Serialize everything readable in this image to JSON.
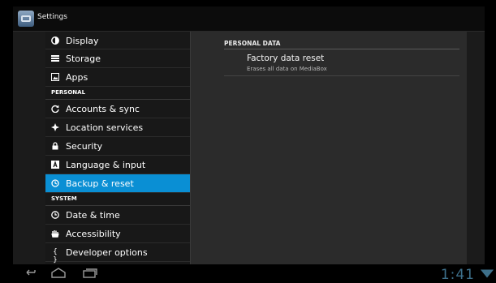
{
  "app": {
    "title": "Settings",
    "icon": "settings-app-icon"
  },
  "sidebar": {
    "items_top": [
      {
        "label": "Display",
        "icon": "display-icon"
      },
      {
        "label": "Storage",
        "icon": "storage-icon"
      },
      {
        "label": "Apps",
        "icon": "apps-icon"
      }
    ],
    "section_personal": "PERSONAL",
    "items_personal": [
      {
        "label": "Accounts & sync",
        "icon": "sync-icon"
      },
      {
        "label": "Location services",
        "icon": "location-icon"
      },
      {
        "label": "Security",
        "icon": "lock-icon"
      },
      {
        "label": "Language & input",
        "icon": "keyboard-icon"
      },
      {
        "label": "Backup & reset",
        "icon": "backup-icon",
        "selected": true
      }
    ],
    "section_system": "SYSTEM",
    "items_system": [
      {
        "label": "Date & time",
        "icon": "clock-icon"
      },
      {
        "label": "Accessibility",
        "icon": "accessibility-hand-icon"
      },
      {
        "label": "Developer options",
        "icon": "braces-icon"
      }
    ]
  },
  "detail": {
    "section_header": "PERSONAL DATA",
    "factory_reset": {
      "title": "Factory data reset",
      "subtitle": "Erases all data on MediaBox"
    }
  },
  "status_bar": {
    "time": "1:41"
  },
  "colors": {
    "accent": "#0a8fd4",
    "clock": "#3d6f8a"
  }
}
